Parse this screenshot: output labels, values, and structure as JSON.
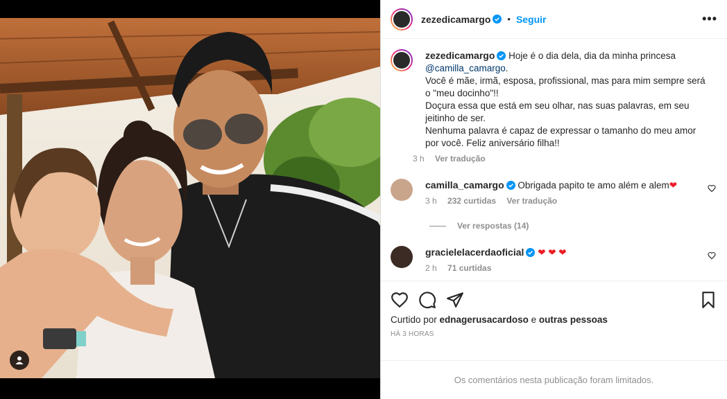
{
  "post": {
    "author": "zezedicamargo",
    "follow_label": "Seguir",
    "dot": "•",
    "more_label": "•••"
  },
  "caption": {
    "author": "zezedicamargo",
    "text_before": "Hoje é o dia dela, dia da minha princesa ",
    "mention": "@camilla_camargo",
    "text_after": ".\nVocê é mãe, irmã, esposa, profissional, mas para mim sempre será o \"meu docinho\"!!\nDoçura essa que está em seu olhar, nas suas palavras, em seu jeitinho de ser.\nNenhuma palavra é capaz de expressar o tamanho do meu amor por você. Feliz aniversário filha!!",
    "time": "3 h",
    "translate": "Ver tradução"
  },
  "comments": [
    {
      "user": "camilla_camargo",
      "text": "Obrigada papito te amo além e alem",
      "emoji": "❤",
      "time": "3 h",
      "likes": "232 curtidas",
      "translate": "Ver tradução",
      "replies": "Ver respostas (14)"
    },
    {
      "user": "gracielelacerdaoficial",
      "text": "",
      "emoji": "❤ ❤ ❤",
      "time": "2 h",
      "likes": "71 curtidas"
    }
  ],
  "footer": {
    "liked_prefix": "Curtido por ",
    "liked_user": "ednagerusacardoso",
    "liked_mid": " e ",
    "liked_others": "outras pessoas",
    "timestamp": "HÁ 3 HORAS",
    "limited_notice": "Os comentários nesta publicação foram limitados."
  },
  "colors": {
    "accent": "#0095f6",
    "mention": "#00376b",
    "heart": "#ed1c24",
    "secondary_text": "#8e8e8e"
  },
  "icons": [
    "verified-badge-icon",
    "heart-icon",
    "comment-icon",
    "share-icon",
    "bookmark-icon",
    "more-icon",
    "user-tag-icon"
  ]
}
